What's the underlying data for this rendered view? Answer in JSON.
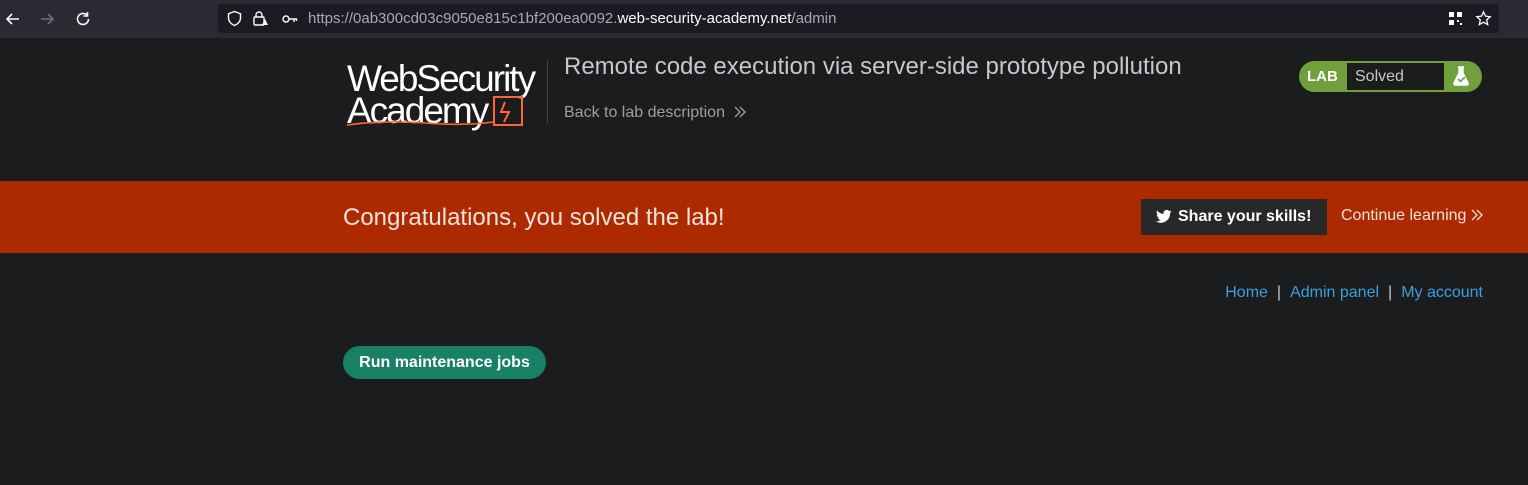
{
  "browser": {
    "url_prefix": "https://0ab300cd03c9050e815c1bf200ea0092.",
    "url_domain": "web-security-academy.net",
    "url_path": "/admin"
  },
  "header": {
    "logo_line1": "WebSecurity",
    "logo_line2": "Academy",
    "lab_title": "Remote code execution via server-side prototype pollution",
    "back_link": "Back to lab description",
    "badge_label": "LAB",
    "badge_status": "Solved"
  },
  "banner": {
    "message": "Congratulations, you solved the lab!",
    "share_label": "Share your skills!",
    "continue_label": "Continue learning"
  },
  "nav": {
    "items": [
      "Home",
      "Admin panel",
      "My account"
    ],
    "separator": "|"
  },
  "main": {
    "run_button": "Run maintenance jobs"
  },
  "colors": {
    "background": "#1b1c1e",
    "banner": "#ad2a00",
    "badge_green": "#70a03c",
    "link_blue": "#3b9fdc",
    "run_button": "#188165"
  }
}
